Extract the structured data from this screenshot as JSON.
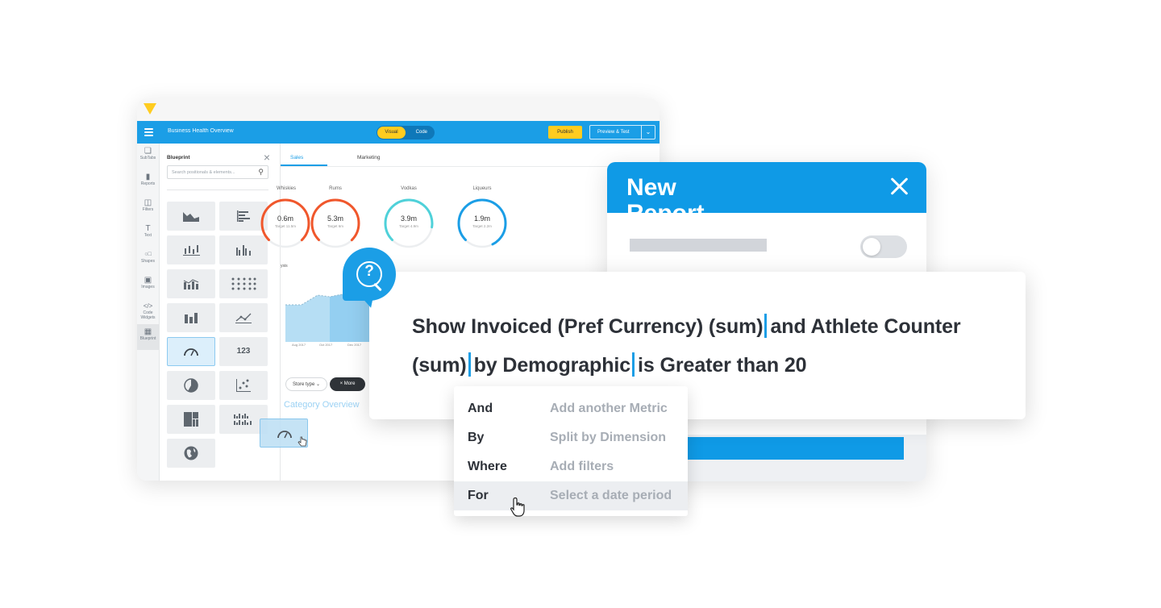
{
  "app": {
    "title": "Business Health Overview",
    "mode_toggle": {
      "visual": "Visual",
      "code": "Code"
    },
    "publish_label": "Publish",
    "preview_label": "Preview & Test",
    "rail": [
      {
        "label": "SubTabs",
        "icon": "subtabs-icon"
      },
      {
        "label": "Reports",
        "icon": "reports-icon"
      },
      {
        "label": "Filters",
        "icon": "filters-icon"
      },
      {
        "label": "Text",
        "icon": "text-icon"
      },
      {
        "label": "Shapes",
        "icon": "shapes-icon"
      },
      {
        "label": "Images",
        "icon": "images-icon"
      },
      {
        "label": "Code Widgets",
        "icon": "code-icon"
      },
      {
        "label": "Blueprint",
        "icon": "blueprint-icon"
      }
    ],
    "blueprint": {
      "title": "Blueprint",
      "search_placeholder": "Search positionals & elements...",
      "number_tile": "123"
    },
    "tabs": [
      "Sales",
      "Marketing"
    ],
    "gauges": [
      {
        "label": "Whiskies",
        "value": "0.6m",
        "target": "Target 11.5m",
        "color": "#f0572c",
        "level": 0.75
      },
      {
        "label": "Rums",
        "value": "5.3m",
        "target": "Target 6m",
        "color": "#f0572c",
        "level": 0.75
      },
      {
        "label": "Vodkas",
        "value": "3.9m",
        "target": "Target 4.9m",
        "color": "#4fd1d9",
        "level": 0.65
      },
      {
        "label": "Liqueurs",
        "value": "1.9m",
        "target": "Target 2.2m",
        "color": "#1b9ee6",
        "level": 0.8
      }
    ],
    "chart_heading": "ysis",
    "chart_axis": [
      "Aug 2017",
      "Oct 2017",
      "Dec 2017"
    ],
    "store_chip": "Store type",
    "more_chip": "More",
    "category_heading": "Category Overview"
  },
  "report": {
    "title": "New Report"
  },
  "query": {
    "line1_a": "Show Invoiced (Pref Currency) (sum)",
    "line1_b": "and Athlete Counter",
    "line2_a": "(sum)",
    "line2_b": "by Demographic",
    "line2_c": "is Greater than 20"
  },
  "dropdown": [
    {
      "key": "And",
      "desc": "Add another Metric"
    },
    {
      "key": "By",
      "desc": "Split by Dimension"
    },
    {
      "key": "Where",
      "desc": "Add filters"
    },
    {
      "key": "For",
      "desc": "Select a date period"
    }
  ],
  "colors": {
    "brand_blue": "#1b9ee6",
    "accent_yellow": "#ffcc1f"
  }
}
